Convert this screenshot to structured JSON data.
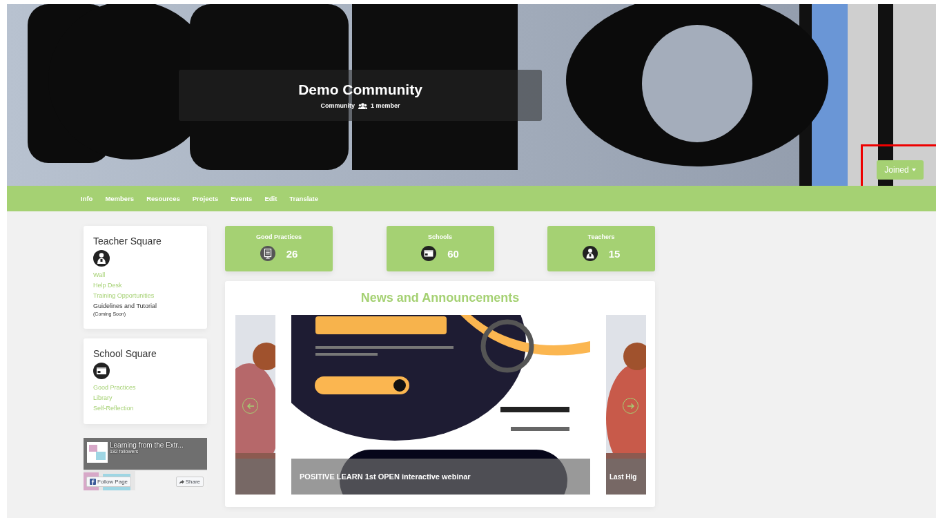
{
  "header": {
    "kind": "picture",
    "title": "Demo Community",
    "type_label": "Community",
    "members": "1 member",
    "join_button": {
      "label": "Joined",
      "highlighted": true
    }
  },
  "nav": [
    {
      "label": "Info"
    },
    {
      "label": "Members"
    },
    {
      "label": "Resources"
    },
    {
      "label": "Projects"
    },
    {
      "label": "Events"
    },
    {
      "label": "Edit"
    },
    {
      "label": "Translate"
    }
  ],
  "sidebar": [
    {
      "title": "Teacher Square",
      "links": [
        {
          "label": "Wall",
          "kind": "link"
        },
        {
          "label": "Help Desk",
          "kind": "link"
        },
        {
          "label": "Training Opportunities",
          "kind": "link"
        },
        {
          "label": "Guidelines and Tutorial",
          "kind": "plain",
          "note": "(Coming Soon)"
        }
      ]
    },
    {
      "title": "School Square",
      "links": [
        {
          "label": "Good Practices",
          "kind": "link"
        },
        {
          "label": "Library",
          "kind": "link"
        },
        {
          "label": "Self-Reflection",
          "kind": "link"
        }
      ]
    }
  ],
  "facebook_widget": {
    "kind": "picture",
    "page_name": "Learning from the Extr...",
    "followers": "182 followers",
    "follow": "Follow Page",
    "share": "Share"
  },
  "stats": [
    {
      "label": "Good Practices",
      "value": "26"
    },
    {
      "label": "Schools",
      "value": "60"
    },
    {
      "label": "Teachers",
      "value": "15"
    }
  ],
  "news": {
    "title": "News and Announcements",
    "slides": [
      {
        "kind": "picture"
      },
      {
        "kind": "picture",
        "caption": "POSITIVE LEARN 1st OPEN interactive webinar"
      },
      {
        "kind": "picture",
        "caption": "Last Hig"
      }
    ]
  }
}
